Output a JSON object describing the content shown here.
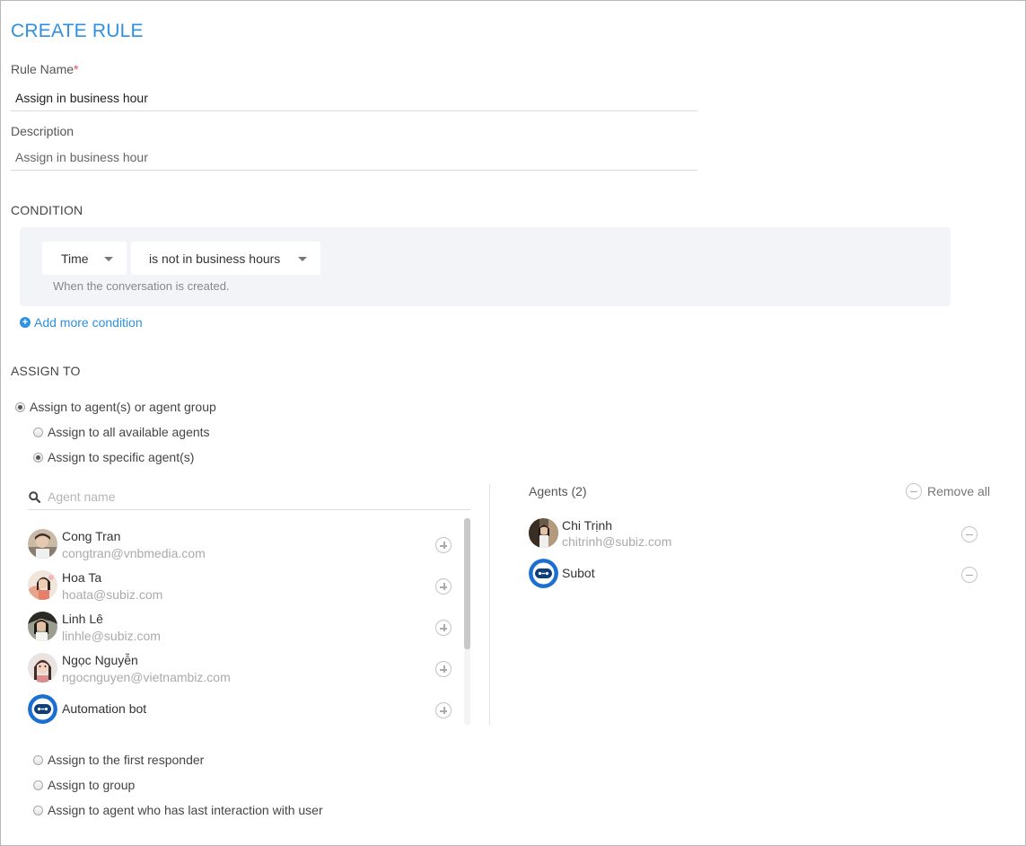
{
  "header": {
    "title": "CREATE RULE"
  },
  "rule_name": {
    "label": "Rule Name",
    "required_mark": "*",
    "value": "Assign in business hour"
  },
  "description": {
    "label": "Description",
    "value": "Assign in business hour"
  },
  "condition": {
    "section_title": "CONDITION",
    "field": "Time",
    "operator": "is not in business hours",
    "hint": "When the conversation is created.",
    "add_label": "Add more condition"
  },
  "assign_to": {
    "section_title": "ASSIGN TO",
    "option_agents": {
      "label": "Assign to agent(s) or agent group",
      "selected": true
    },
    "sub_all": {
      "label": "Assign to all available agents",
      "selected": false
    },
    "sub_specific": {
      "label": "Assign to specific agent(s)",
      "selected": true
    },
    "option_first": {
      "label": "Assign to the first responder",
      "selected": false
    },
    "option_group": {
      "label": "Assign to group",
      "selected": false
    },
    "option_last": {
      "label": "Assign to agent who has last interaction with user",
      "selected": false
    }
  },
  "search": {
    "placeholder": "Agent name",
    "icon": "search-icon"
  },
  "available_agents": [
    {
      "name": "Cong Tran",
      "email": "congtran@vnbmedia.com",
      "avatar": "photo"
    },
    {
      "name": "Hoa Ta",
      "email": "hoata@subiz.com",
      "avatar": "photo"
    },
    {
      "name": "Linh Lê",
      "email": "linhle@subiz.com",
      "avatar": "photo"
    },
    {
      "name": "Ngọc Nguyễn",
      "email": "ngocnguyen@vietnambiz.com",
      "avatar": "photo"
    },
    {
      "name": "Automation bot",
      "email": "",
      "avatar": "bot"
    }
  ],
  "selected_panel": {
    "title": "Agents (2)",
    "remove_all": "Remove all"
  },
  "selected_agents": [
    {
      "name": "Chi Trịnh",
      "email": "chitrinh@subiz.com",
      "avatar": "photo"
    },
    {
      "name": "Subot",
      "email": "",
      "avatar": "bot"
    }
  ],
  "colors": {
    "accent": "#2f8fe0",
    "bot": "#1a6fd1",
    "required": "#e05050"
  }
}
